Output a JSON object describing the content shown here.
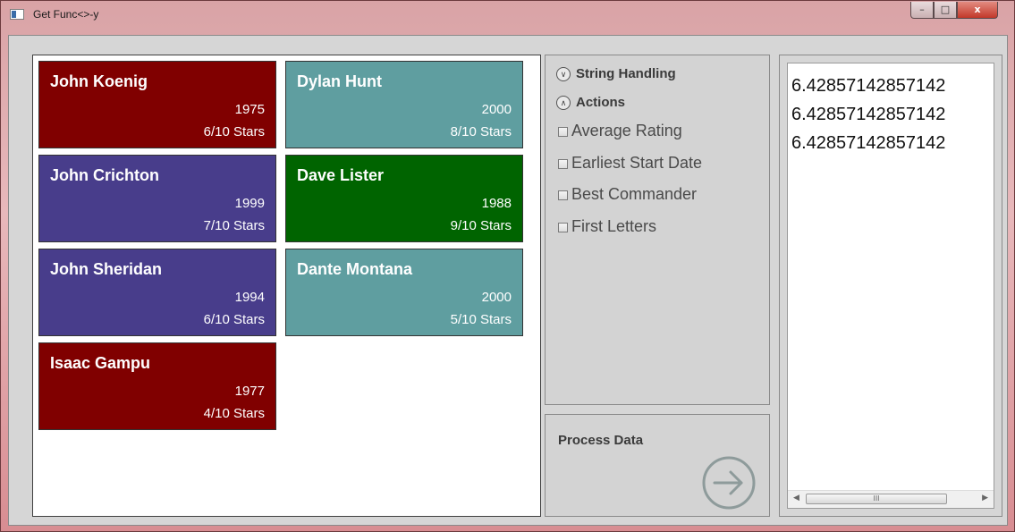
{
  "window": {
    "title": "Get Func<>-y",
    "minimize": "–",
    "maximize": "□",
    "close": "x"
  },
  "cards": [
    {
      "name": "John Koenig",
      "year": "1975",
      "stars": "6/10 Stars",
      "color": "#800000"
    },
    {
      "name": "Dylan Hunt",
      "year": "2000",
      "stars": "8/10 Stars",
      "color": "#5f9ea0"
    },
    {
      "name": "John Crichton",
      "year": "1999",
      "stars": "7/10 Stars",
      "color": "#483d8b"
    },
    {
      "name": "Dave Lister",
      "year": "1988",
      "stars": "9/10 Stars",
      "color": "#006400"
    },
    {
      "name": "John Sheridan",
      "year": "1994",
      "stars": "6/10 Stars",
      "color": "#483d8b"
    },
    {
      "name": "Dante Montana",
      "year": "2000",
      "stars": "5/10 Stars",
      "color": "#5f9ea0"
    },
    {
      "name": "Isaac Gampu",
      "year": "1977",
      "stars": "4/10 Stars",
      "color": "#800000"
    }
  ],
  "options": {
    "string_handling": {
      "label": "String Handling",
      "icon": "chevron-down-circle-icon"
    },
    "actions": {
      "label": "Actions",
      "icon": "chevron-up-circle-icon"
    },
    "checkboxes": [
      {
        "label": "Average Rating",
        "checked": false
      },
      {
        "label": "Earliest Start Date",
        "checked": false
      },
      {
        "label": "Best Commander",
        "checked": false
      },
      {
        "label": "First Letters",
        "checked": false
      }
    ]
  },
  "process": {
    "label": "Process Data",
    "icon": "arrow-right-circle-icon"
  },
  "output": {
    "lines": [
      "6.42857142857142",
      "6.42857142857142",
      "6.42857142857142"
    ],
    "scroll_grip": "III"
  }
}
